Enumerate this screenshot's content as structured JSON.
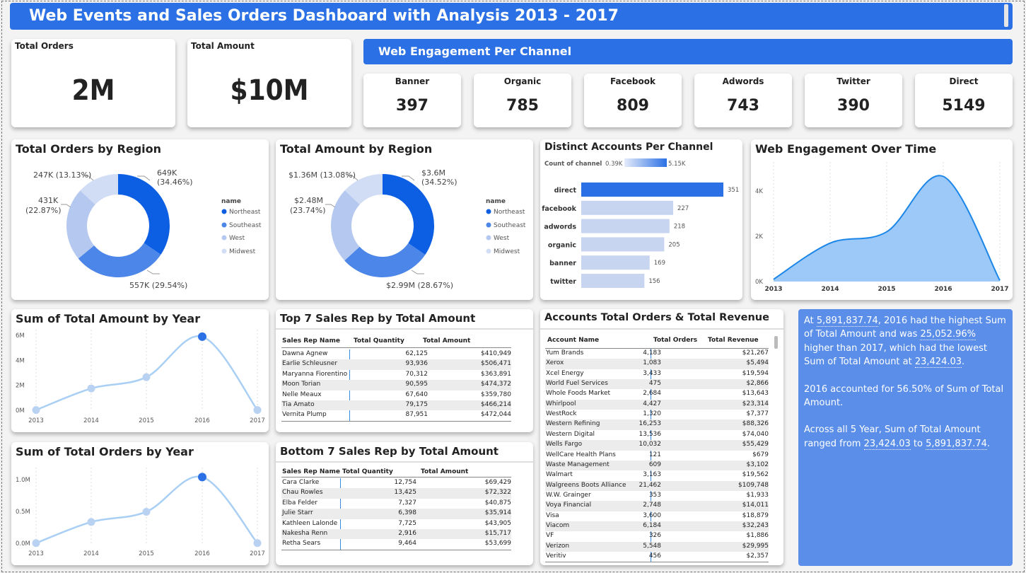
{
  "title": "Web Events and Sales Orders Dashboard with Analysis 2013 - 2017",
  "kpis": {
    "orders_label": "Total Orders",
    "orders_value": "2M",
    "amount_label": "Total Amount",
    "amount_value": "$10M"
  },
  "web_engagement": {
    "title": "Web Engagement Per Channel",
    "channels": [
      {
        "label": "Banner",
        "value": "397"
      },
      {
        "label": "Organic",
        "value": "785"
      },
      {
        "label": "Facebook",
        "value": "809"
      },
      {
        "label": "Adwords",
        "value": "743"
      },
      {
        "label": "Twitter",
        "value": "390"
      },
      {
        "label": "Direct",
        "value": "5149"
      }
    ]
  },
  "colors": {
    "northeast": "#0c5ee3",
    "southeast": "#4c86e8",
    "west": "#b5c8ef",
    "midwest": "#d1ddf4",
    "accent": "#2b70e4"
  },
  "orders_by_region": {
    "title": "Total Orders by Region",
    "legend_title": "name",
    "legend": [
      "Northeast",
      "Southeast",
      "West",
      "Midwest"
    ],
    "labels": [
      {
        "v": "649K",
        "p": "(34.46%)"
      },
      {
        "v": "557K (29.54%)",
        "p": ""
      },
      {
        "v": "431K",
        "p": "(22.87%)"
      },
      {
        "v": "247K (13.13%)",
        "p": ""
      }
    ]
  },
  "amount_by_region": {
    "title": "Total Amount by Region",
    "legend_title": "name",
    "legend": [
      "Northeast",
      "Southeast",
      "West",
      "Midwest"
    ],
    "labels": [
      {
        "v": "$3.6M",
        "p": "(34.52%)"
      },
      {
        "v": "$2.99M (28.67%)",
        "p": ""
      },
      {
        "v": "$2.48M",
        "p": "(23.74%)"
      },
      {
        "v": "$1.36M (13.08%)",
        "p": ""
      }
    ]
  },
  "accounts_per_channel": {
    "title": "Distinct Accounts Per Channel",
    "legend_label": "Count of channel",
    "legend_min": "0.39K",
    "legend_max": "5.15K"
  },
  "web_over_time_title": "Web Engagement Over Time",
  "amount_by_year_title": "Sum of Total Amount by Year",
  "orders_by_year_title": "Sum of Total Orders by Year",
  "chart_data": [
    {
      "type": "pie",
      "title": "Total Orders by Region",
      "categories": [
        "Northeast",
        "Southeast",
        "West",
        "Midwest"
      ],
      "values": [
        649000,
        557000,
        431000,
        247000
      ],
      "percents": [
        34.46,
        29.54,
        22.87,
        13.13
      ],
      "legend_position": "right"
    },
    {
      "type": "pie",
      "title": "Total Amount by Region",
      "categories": [
        "Northeast",
        "Southeast",
        "West",
        "Midwest"
      ],
      "values": [
        3600000,
        2990000,
        2480000,
        1360000
      ],
      "percents": [
        34.52,
        28.67,
        23.74,
        13.08
      ],
      "legend_position": "right"
    },
    {
      "type": "bar",
      "title": "Distinct Accounts Per Channel",
      "categories": [
        "direct",
        "facebook",
        "adwords",
        "organic",
        "banner",
        "twitter"
      ],
      "values": [
        351,
        227,
        218,
        205,
        169,
        156
      ],
      "orientation": "horizontal"
    },
    {
      "type": "area",
      "title": "Web Engagement Over Time",
      "x": [
        "2013",
        "2014",
        "2015",
        "2016",
        "2017"
      ],
      "values": [
        100,
        1700,
        2200,
        4650,
        50
      ],
      "yticks": [
        "0K",
        "2K",
        "4K"
      ],
      "ylim": [
        0,
        5100
      ]
    },
    {
      "type": "line",
      "title": "Sum of Total Amount by Year",
      "x": [
        "2013",
        "2014",
        "2015",
        "2016",
        "2017"
      ],
      "values": [
        23000,
        1750000,
        2650000,
        5891837.74,
        23424.03
      ],
      "yticks": [
        "0M",
        "2M",
        "4M",
        "6M"
      ],
      "ylim": [
        0,
        6000000
      ]
    },
    {
      "type": "line",
      "title": "Sum of Total Orders by Year",
      "x": [
        "2013",
        "2014",
        "2015",
        "2016",
        "2017"
      ],
      "values": [
        3000,
        335000,
        495000,
        1040000,
        3000
      ],
      "yticks": [
        "0.0M",
        "0.5M",
        "1.0M"
      ],
      "ylim": [
        0,
        1100000
      ]
    }
  ],
  "top7": {
    "title": "Top 7 Sales Rep by Total Amount",
    "columns": [
      "Sales Rep Name",
      "Total Quantity",
      "Total Amount"
    ],
    "rows": [
      [
        "Dawna Agnew",
        "62,125",
        "$410,949"
      ],
      [
        "Earlie Schleusner",
        "93,936",
        "$506,471"
      ],
      [
        "Maryanna Fiorentino",
        "70,312",
        "$363,891"
      ],
      [
        "Moon Torian",
        "90,595",
        "$474,372"
      ],
      [
        "Nelle Meaux",
        "67,640",
        "$359,780"
      ],
      [
        "Tia Amato",
        "79,175",
        "$466,214"
      ],
      [
        "Vernita Plump",
        "87,951",
        "$472,044"
      ]
    ]
  },
  "bottom7": {
    "title": "Bottom 7 Sales Rep by Total Amount",
    "columns": [
      "Sales Rep Name",
      "Total Quantity",
      "Total Amount"
    ],
    "rows": [
      [
        "Cara Clarke",
        "12,754",
        "$69,429"
      ],
      [
        "Chau Rowles",
        "13,425",
        "$72,322"
      ],
      [
        "Elba Felder",
        "7,327",
        "$40,875"
      ],
      [
        "Julie Starr",
        "6,398",
        "$35,914"
      ],
      [
        "Kathleen Lalonde",
        "7,725",
        "$43,905"
      ],
      [
        "Nakesha Renn",
        "2,916",
        "$15,717"
      ],
      [
        "Retha Sears",
        "9,464",
        "$53,699"
      ]
    ]
  },
  "accounts": {
    "title": "Accounts Total Orders & Total Revenue",
    "columns": [
      "Account Name",
      "Total Orders",
      "Total Revenue"
    ],
    "rows": [
      [
        "Yum Brands",
        "4,183",
        "$21,267"
      ],
      [
        "Xerox",
        "1,083",
        "$5,494"
      ],
      [
        "Xcel Energy",
        "3,433",
        "$19,594"
      ],
      [
        "World Fuel Services",
        "475",
        "$2,866"
      ],
      [
        "Whole Foods Market",
        "2,684",
        "$13,643"
      ],
      [
        "Whirlpool",
        "4,427",
        "$23,314"
      ],
      [
        "WestRock",
        "1,320",
        "$7,377"
      ],
      [
        "Western Refining",
        "16,253",
        "$88,326"
      ],
      [
        "Western Digital",
        "13,536",
        "$74,040"
      ],
      [
        "Wells Fargo",
        "10,032",
        "$55,429"
      ],
      [
        "WellCare Health Plans",
        "121",
        "$679"
      ],
      [
        "Waste Management",
        "609",
        "$3,102"
      ],
      [
        "Walmart",
        "3,163",
        "$19,562"
      ],
      [
        "Walgreens Boots Alliance",
        "21,462",
        "$109,748"
      ],
      [
        "W.W. Grainger",
        "353",
        "$1,933"
      ],
      [
        "Voya Financial",
        "2,748",
        "$14,011"
      ],
      [
        "Visa",
        "3,600",
        "$18,879"
      ],
      [
        "Viacom",
        "6,184",
        "$32,243"
      ],
      [
        "VF",
        "326",
        "$1,886"
      ],
      [
        "Verizon",
        "5,548",
        "$29,995"
      ],
      [
        "Veritiv",
        "456",
        "$2,357"
      ]
    ]
  },
  "insight": {
    "p1a": "At ",
    "p1b": "5,891,837.74",
    "p1c": ", 2016 had the highest Sum of Total Amount and was ",
    "p1d": "25,052.96%",
    "p1e": " higher than 2017, which had the lowest Sum of Total Amount at ",
    "p1f": "23,424.03",
    "p1g": ".",
    "p2": "2016 accounted for 56.50% of Sum of Total Amount.",
    "p3a": "Across all 5 Year, Sum of Total Amount ranged from ",
    "p3b": "23,424.03",
    "p3c": " to ",
    "p3d": "5,891,837.74",
    "p3e": "."
  }
}
